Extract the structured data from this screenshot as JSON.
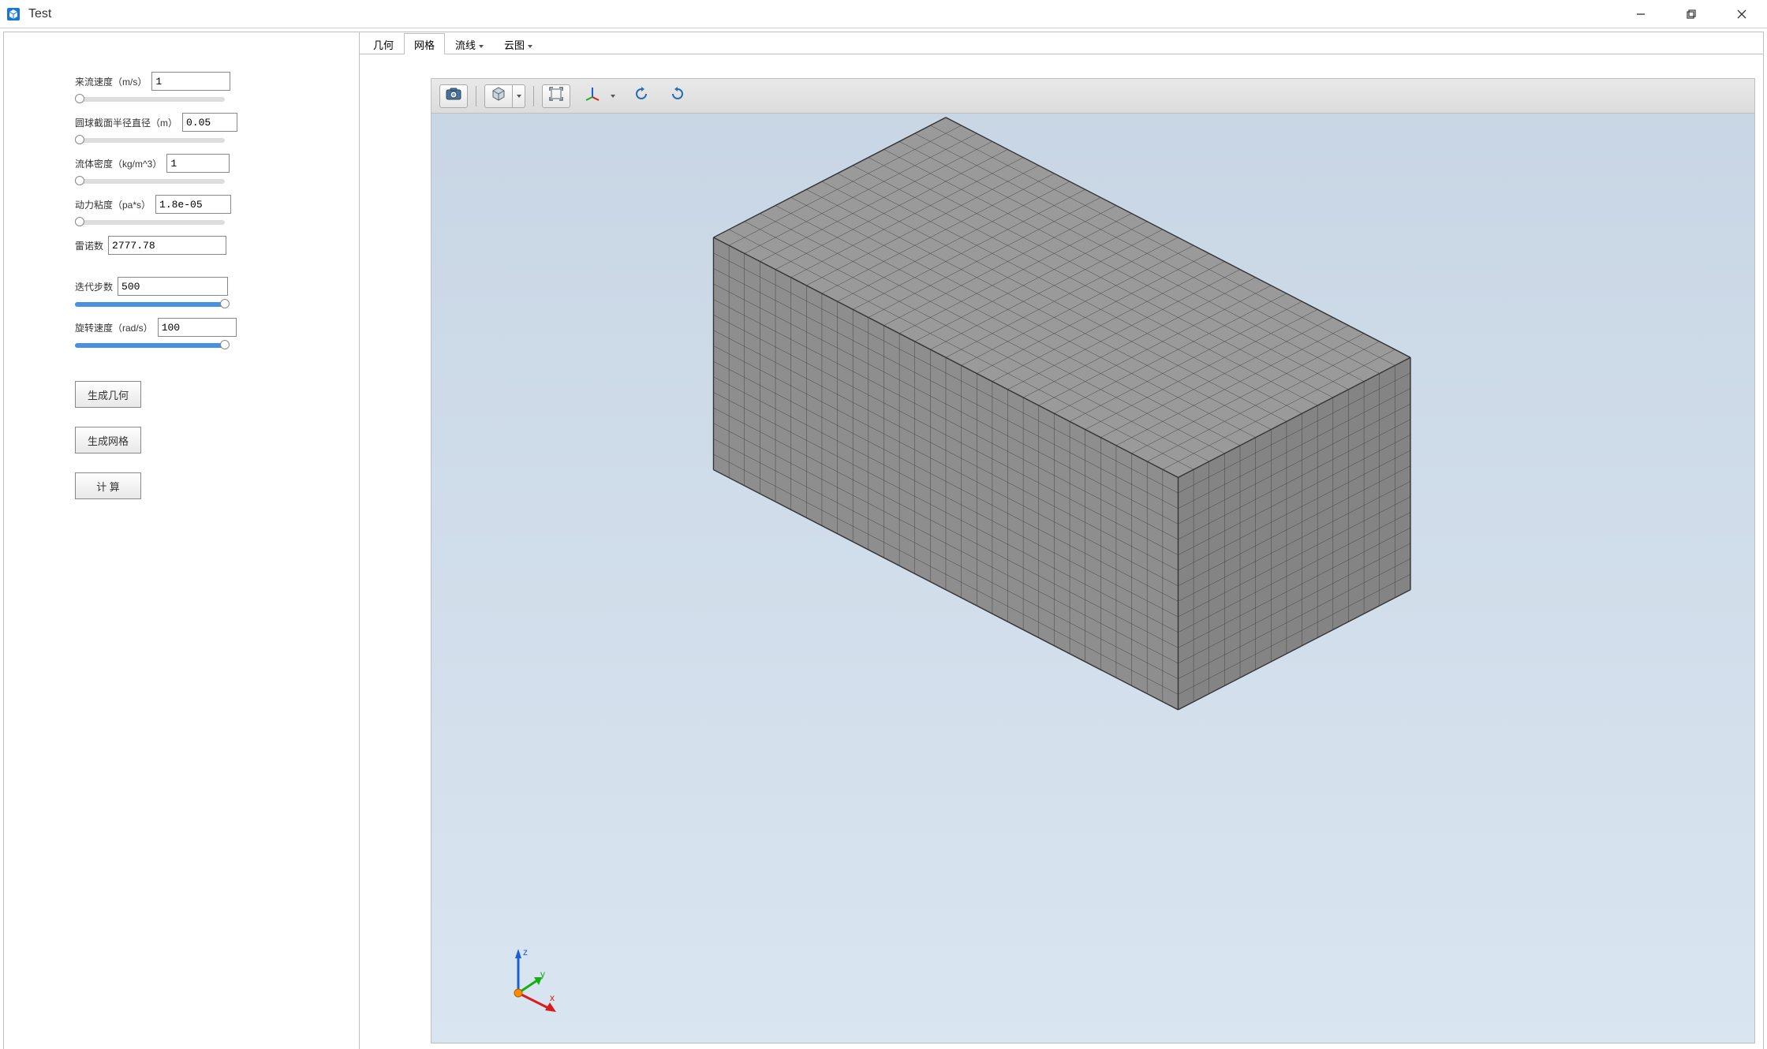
{
  "window": {
    "title": "Test"
  },
  "sidebar": {
    "fields": {
      "flow_velocity": {
        "label": "来流速度（m/s）",
        "value": "1"
      },
      "sphere_radius": {
        "label": "圆球截面半径直径（m）",
        "value": "0.05"
      },
      "fluid_density": {
        "label": "流体密度（kg/m^3）",
        "value": "1"
      },
      "dynamic_viscosity": {
        "label": "动力粘度（pa*s）",
        "value": "1.8e-05"
      },
      "reynolds": {
        "label": "雷诺数",
        "value": "2777.78"
      },
      "iterations": {
        "label": "迭代步数",
        "value": "500"
      },
      "rotation_speed": {
        "label": "旋转速度（rad/s）",
        "value": "100"
      }
    },
    "buttons": {
      "gen_geometry": "生成几何",
      "gen_mesh": "生成网格",
      "compute": "计 算"
    }
  },
  "tabs": {
    "geometry": "几何",
    "mesh": "网格",
    "streamline": "流线",
    "contour": "云图"
  },
  "viewport": {
    "triad": {
      "x": "x",
      "y": "y",
      "z": "z"
    },
    "toolbar_icons": {
      "snapshot": "camera-icon",
      "view_cube": "cube-icon",
      "fit_view": "fit-icon",
      "axes": "axes-icon",
      "rotate_cw": "rotate-cw-icon",
      "rotate_ccw": "rotate-ccw-icon"
    }
  }
}
